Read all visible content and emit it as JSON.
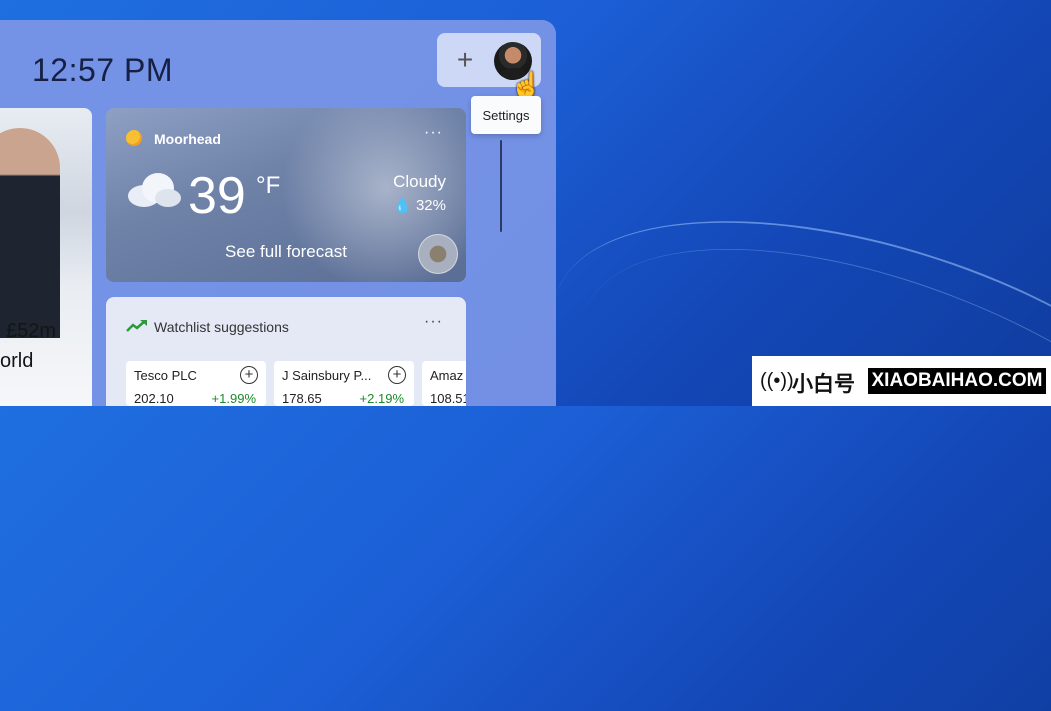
{
  "header": {
    "time": "12:57 PM"
  },
  "topbar": {
    "add_label": "+",
    "tooltip": "Settings"
  },
  "news": {
    "line1": "£52m",
    "line2": "orld"
  },
  "weather": {
    "location": "Moorhead",
    "more": "···",
    "temperature": "39",
    "unit": "°F",
    "condition": "Cloudy",
    "humidity": "💧 32%",
    "forecast_link": "See full forecast"
  },
  "watchlist": {
    "title": "Watchlist suggestions",
    "more": "···",
    "stocks": [
      {
        "name": "Tesco PLC",
        "price": "202.10",
        "change": "+1.99%"
      },
      {
        "name": "J Sainsbury P...",
        "price": "178.65",
        "change": "+2.19%"
      },
      {
        "name": "Amaz",
        "price": "108.51",
        "change": ""
      }
    ]
  },
  "brand": {
    "cn": "小白号",
    "en": "XIAOBAIHAO.COM"
  }
}
